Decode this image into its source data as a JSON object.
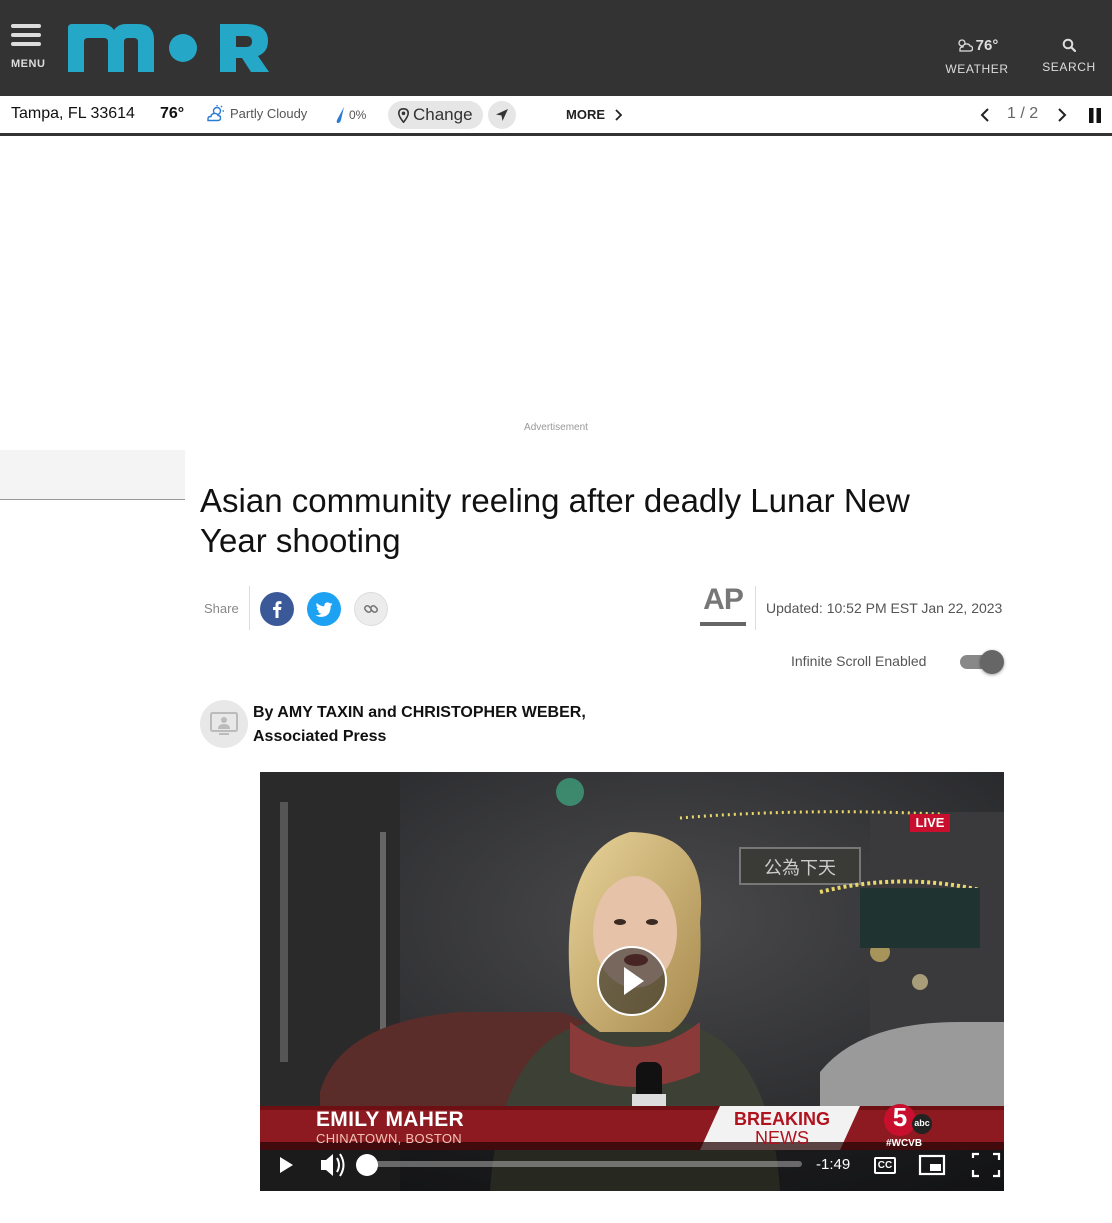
{
  "header": {
    "menu_label": "MENU",
    "logo_text": "moR",
    "weather_temp": "76°",
    "weather_label": "WEATHER",
    "search_label": "SEARCH"
  },
  "weather_bar": {
    "location": "Tampa, FL 33614",
    "temp": "76°",
    "condition": "Partly Cloudy",
    "precip": "0%",
    "change_label": "Change",
    "more_label": "MORE",
    "pager": "1 / 2"
  },
  "ad": {
    "label": "Advertisement"
  },
  "article": {
    "headline_line1": "Asian community reeling after deadly Lunar New",
    "headline_line2": "Year shooting",
    "share_label": "Share",
    "source_logo": "AP",
    "updated": "Updated: 10:52 PM EST Jan 22, 2023",
    "infinite_scroll_label": "Infinite Scroll Enabled",
    "infinite_scroll_on": true,
    "byline_line1": "By AMY TAXIN and CHRISTOPHER WEBER,",
    "byline_line2": "Associated Press"
  },
  "video": {
    "live_badge": "LIVE",
    "reporter_name": "EMILY MAHER",
    "reporter_location": "CHINATOWN, BOSTON",
    "breaking_line1": "BREAKING",
    "breaking_line2": "NEWS",
    "station_tag": "#WCVB",
    "station_network": "abc",
    "station_number": "5",
    "time_remaining": "-1:49",
    "cc_label": "CC",
    "sign_text": "公為下天",
    "progress": 0.0
  },
  "colors": {
    "header_bg": "#333333",
    "logo": "#25a8c8",
    "facebook": "#3b5998",
    "twitter": "#1da1f2",
    "lower_third": "#8c1a20",
    "live_red": "#c8102e"
  }
}
